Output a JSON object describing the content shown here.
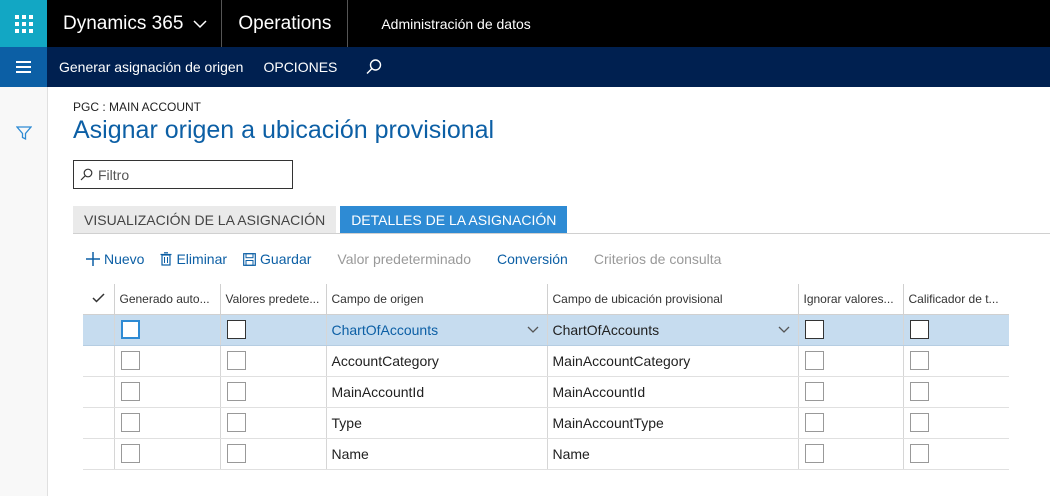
{
  "topbar": {
    "brand": "Dynamics 365",
    "module": "Operations",
    "workspace": "Administración de datos"
  },
  "actionbar": {
    "generate_label": "Generar asignación de origen",
    "options_label": "OPCIONES"
  },
  "page": {
    "caption": "PGC : MAIN ACCOUNT",
    "title": "Asignar origen a ubicación provisional",
    "filter_placeholder": "Filtro"
  },
  "tabs": {
    "visualization": "VISUALIZACIÓN DE LA ASIGNACIÓN",
    "details": "DETALLES DE LA ASIGNACIÓN"
  },
  "toolbar": {
    "new": "Nuevo",
    "delete": "Eliminar",
    "save": "Guardar",
    "default_value": "Valor predeterminado",
    "conversion": "Conversión",
    "query_criteria": "Criterios de consulta"
  },
  "grid": {
    "columns": [
      "Generado auto...",
      "Valores predete...",
      "Campo de origen",
      "Campo de ubicación provisional",
      "Ignorar valores...",
      "Calificador de t..."
    ],
    "rows": [
      {
        "source": "ChartOfAccounts",
        "staging": "ChartOfAccounts"
      },
      {
        "source": "AccountCategory",
        "staging": "MainAccountCategory"
      },
      {
        "source": "MainAccountId",
        "staging": "MainAccountId"
      },
      {
        "source": "Type",
        "staging": "MainAccountType"
      },
      {
        "source": "Name",
        "staging": "Name"
      }
    ]
  },
  "colors": {
    "topbar_bg": "#000000",
    "waffle_bg": "#12a7c4",
    "actionbar_bg": "#002050",
    "accent": "#0c5fa5",
    "active_tab": "#2e8bd4",
    "selected_row": "#c6dcef"
  },
  "icons": [
    "waffle-icon",
    "chevron-down-icon",
    "hamburger-icon",
    "search-icon",
    "filter-icon",
    "plus-icon",
    "trash-icon",
    "save-icon",
    "checkmark-icon"
  ]
}
